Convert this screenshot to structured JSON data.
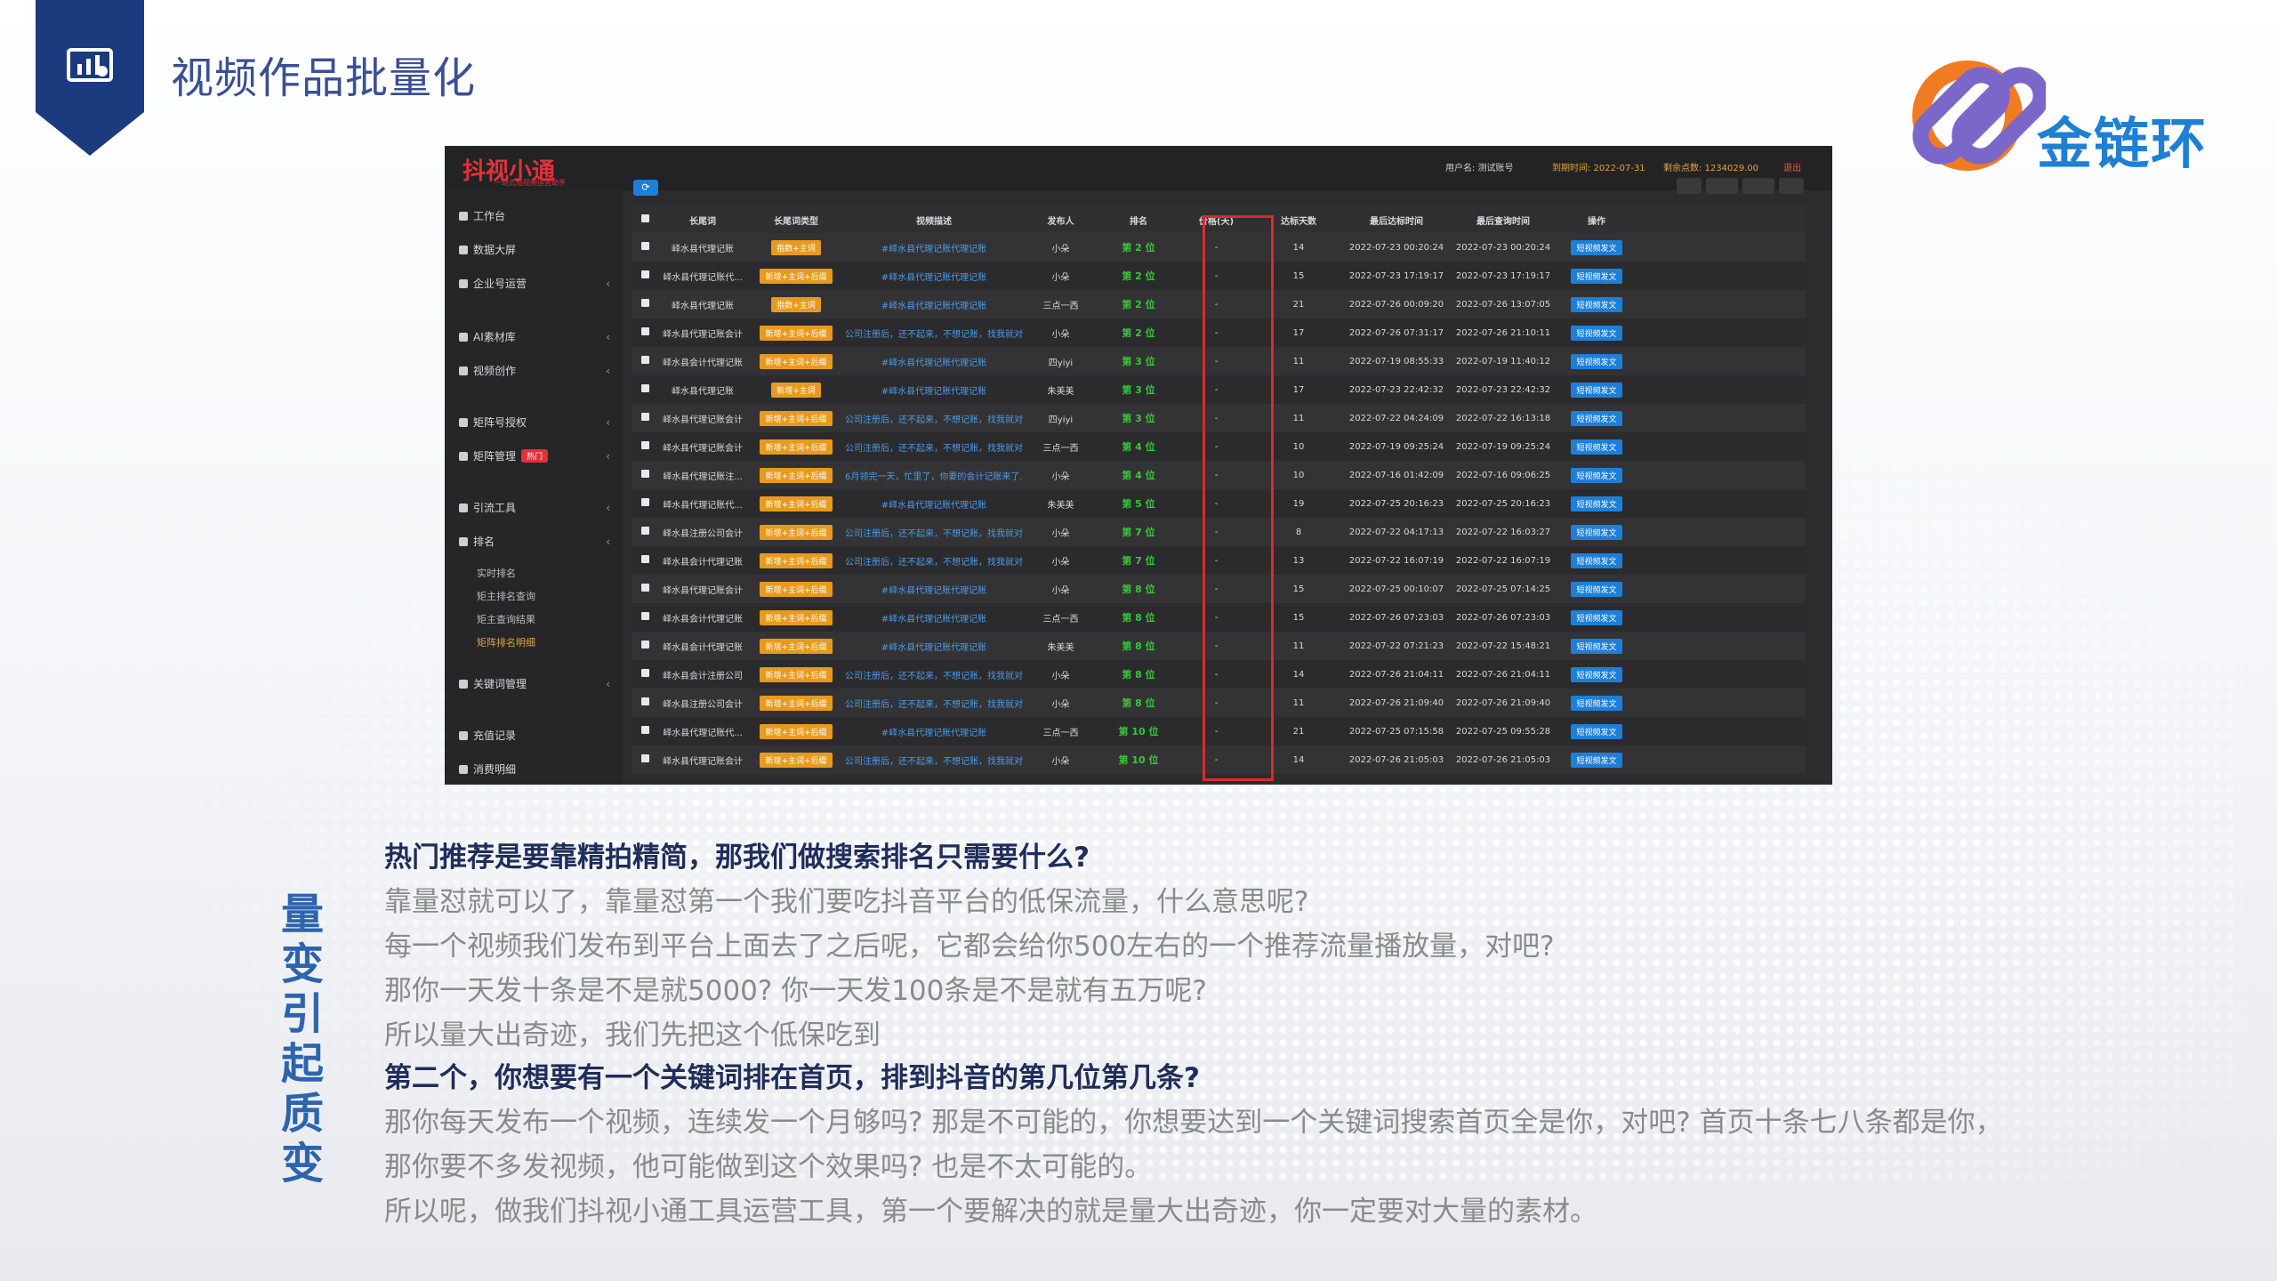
{
  "page": {
    "title": "视频作品批量化",
    "brand": "金链环",
    "side_title": "量变引起质变"
  },
  "app": {
    "logo": "抖视小通",
    "logo_sub": "一站式短视频运营助手",
    "user": "用户名: 测试账号",
    "expire": "到期时间: 2022-07-31",
    "balance": "剩余点数: 1234029.00",
    "logout": "退出"
  },
  "sidebar": [
    {
      "label": "工作台",
      "icon": "desktop-icon",
      "chev": false
    },
    {
      "label": "数据大屏",
      "icon": "chart-icon",
      "chev": false
    },
    {
      "label": "企业号运营",
      "icon": "cloud-icon",
      "chev": true
    },
    {
      "label": "AI素材库",
      "icon": "folder-icon",
      "chev": true
    },
    {
      "label": "视频创作",
      "icon": "film-icon",
      "chev": true
    },
    {
      "label": "矩阵号授权",
      "icon": "key-icon",
      "chev": true
    },
    {
      "label": "矩阵管理",
      "icon": "grid-icon",
      "chev": true,
      "badge": "热门"
    },
    {
      "label": "引流工具",
      "icon": "send-icon",
      "chev": true
    },
    {
      "label": "排名",
      "icon": "rank-icon",
      "chev": true
    },
    {
      "label": "实时排名",
      "sub": true
    },
    {
      "label": "矩主排名查询",
      "sub": true
    },
    {
      "label": "矩主查询结果",
      "sub": true
    },
    {
      "label": "矩阵排名明细",
      "sub": true,
      "active": true
    },
    {
      "label": "关键词管理",
      "icon": "doc-icon",
      "chev": true
    },
    {
      "label": "充值记录",
      "icon": "yen-icon",
      "chev": false
    },
    {
      "label": "消费明细",
      "icon": "list-icon",
      "chev": false
    }
  ],
  "table": {
    "headers": [
      "长尾词",
      "长尾词类型",
      "视频描述",
      "发布人",
      "排名",
      "价格(天)",
      "达标天数",
      "最后达标时间",
      "最后查询时间",
      "操作"
    ],
    "rows": [
      {
        "kw": "峄水县代理记账",
        "type": "指数+主词",
        "desc": "#峄水县代理记账代理记账",
        "pub": "小朵",
        "rank": "第 2 位",
        "price": "-",
        "days": "14",
        "last": "2022-07-23 00:20:24",
        "query": "2022-07-23 00:20:24",
        "op": "短视频发文"
      },
      {
        "kw": "峄水县代理记账代...",
        "type": "新增+主词+后缀",
        "desc": "#峄水县代理记账代理记账",
        "pub": "小朵",
        "rank": "第 2 位",
        "price": "-",
        "days": "15",
        "last": "2022-07-23 17:19:17",
        "query": "2022-07-23 17:19:17",
        "op": "短视频发文"
      },
      {
        "kw": "峄水县代理记账",
        "type": "指数+主词",
        "desc": "#峄水县代理记账代理记账",
        "pub": "三点一西",
        "rank": "第 2 位",
        "price": "-",
        "days": "21",
        "last": "2022-07-26 00:09:20",
        "query": "2022-07-26 13:07:05",
        "op": "短视频发文"
      },
      {
        "kw": "峄水县代理记账会计",
        "type": "新增+主词+后缀",
        "desc": "公司注册后，还不起来，不想记账，找我就对...",
        "pub": "小朵",
        "rank": "第 2 位",
        "price": "-",
        "days": "17",
        "last": "2022-07-26 07:31:17",
        "query": "2022-07-26 21:10:11",
        "op": "短视频发文"
      },
      {
        "kw": "峄水县会计代理记账",
        "type": "新增+主词+后缀",
        "desc": "#峄水县代理记账代理记账",
        "pub": "四yiyi",
        "rank": "第 3 位",
        "price": "-",
        "days": "11",
        "last": "2022-07-19 08:55:33",
        "query": "2022-07-19 11:40:12",
        "op": "短视频发文"
      },
      {
        "kw": "峄水县代理记账",
        "type": "新增+主词",
        "desc": "#峄水县代理记账代理记账",
        "pub": "朱美美",
        "rank": "第 3 位",
        "price": "-",
        "days": "17",
        "last": "2022-07-23 22:42:32",
        "query": "2022-07-23 22:42:32",
        "op": "短视频发文"
      },
      {
        "kw": "峄水县代理记账会计",
        "type": "新增+主词+后缀",
        "desc": "公司注册后，还不起来，不想记账，找我就对...",
        "pub": "四yiyi",
        "rank": "第 3 位",
        "price": "-",
        "days": "11",
        "last": "2022-07-22 04:24:09",
        "query": "2022-07-22 16:13:18",
        "op": "短视频发文"
      },
      {
        "kw": "峄水县代理记账会计",
        "type": "新增+主词+后缀",
        "desc": "公司注册后，还不起来，不想记账，找我就对...",
        "pub": "三点一西",
        "rank": "第 4 位",
        "price": "-",
        "days": "10",
        "last": "2022-07-19 09:25:24",
        "query": "2022-07-19 09:25:24",
        "op": "短视频发文"
      },
      {
        "kw": "峄水县代理记账注...",
        "type": "新增+主词+后缀",
        "desc": "6月领完一天，忙里了，你要的会计记账来了...",
        "pub": "小朵",
        "rank": "第 4 位",
        "price": "-",
        "days": "10",
        "last": "2022-07-16 01:42:09",
        "query": "2022-07-16 09:06:25",
        "op": "短视频发文"
      },
      {
        "kw": "峄水县代理记账代...",
        "type": "新增+主词+后缀",
        "desc": "#峄水县代理记账代理记账",
        "pub": "朱美美",
        "rank": "第 5 位",
        "price": "-",
        "days": "19",
        "last": "2022-07-25 20:16:23",
        "query": "2022-07-25 20:16:23",
        "op": "短视频发文"
      },
      {
        "kw": "峄水县注册公司会计",
        "type": "新增+主词+后缀",
        "desc": "公司注册后，还不起来，不想记账，找我就对...",
        "pub": "小朵",
        "rank": "第 7 位",
        "price": "-",
        "days": "8",
        "last": "2022-07-22 04:17:13",
        "query": "2022-07-22 16:03:27",
        "op": "短视频发文"
      },
      {
        "kw": "峄水县会计代理记账",
        "type": "新增+主词+后缀",
        "desc": "公司注册后，还不起来，不想记账，找我就对...",
        "pub": "小朵",
        "rank": "第 7 位",
        "price": "-",
        "days": "13",
        "last": "2022-07-22 16:07:19",
        "query": "2022-07-22 16:07:19",
        "op": "短视频发文"
      },
      {
        "kw": "峄水县代理记账会计",
        "type": "新增+主词+后缀",
        "desc": "#峄水县代理记账代理记账",
        "pub": "小朵",
        "rank": "第 8 位",
        "price": "-",
        "days": "15",
        "last": "2022-07-25 00:10:07",
        "query": "2022-07-25 07:14:25",
        "op": "短视频发文"
      },
      {
        "kw": "峄水县会计代理记账",
        "type": "新增+主词+后缀",
        "desc": "#峄水县代理记账代理记账",
        "pub": "三点一西",
        "rank": "第 8 位",
        "price": "-",
        "days": "15",
        "last": "2022-07-26 07:23:03",
        "query": "2022-07-26 07:23:03",
        "op": "短视频发文"
      },
      {
        "kw": "峄水县会计代理记账",
        "type": "新增+主词+后缀",
        "desc": "#峄水县代理记账代理记账",
        "pub": "朱美美",
        "rank": "第 8 位",
        "price": "-",
        "days": "11",
        "last": "2022-07-22 07:21:23",
        "query": "2022-07-22 15:48:21",
        "op": "短视频发文"
      },
      {
        "kw": "峄水县会计注册公司",
        "type": "新增+主词+后缀",
        "desc": "公司注册后，还不起来，不想记账，找我就对...",
        "pub": "小朵",
        "rank": "第 8 位",
        "price": "-",
        "days": "14",
        "last": "2022-07-26 21:04:11",
        "query": "2022-07-26 21:04:11",
        "op": "短视频发文"
      },
      {
        "kw": "峄水县注册公司会计",
        "type": "新增+主词+后缀",
        "desc": "公司注册后，还不起来，不想记账，找我就对...",
        "pub": "小朵",
        "rank": "第 8 位",
        "price": "-",
        "days": "11",
        "last": "2022-07-26 21:09:40",
        "query": "2022-07-26 21:09:40",
        "op": "短视频发文"
      },
      {
        "kw": "峄水县代理记账代...",
        "type": "新增+主词+后缀",
        "desc": "#峄水县代理记账代理记账",
        "pub": "三点一西",
        "rank": "第 10 位",
        "price": "-",
        "days": "21",
        "last": "2022-07-25 07:15:58",
        "query": "2022-07-25 09:55:28",
        "op": "短视频发文"
      },
      {
        "kw": "峄水县代理记账会计",
        "type": "新增+主词+后缀",
        "desc": "公司注册后，还不起来，不想记账，找我就对...",
        "pub": "小朵",
        "rank": "第 10 位",
        "price": "-",
        "days": "14",
        "last": "2022-07-26 21:05:03",
        "query": "2022-07-26 21:05:03",
        "op": "短视频发文"
      }
    ]
  },
  "paragraphs": [
    {
      "text": "热门推荐是要靠精拍精简，那我们做搜索排名只需要什么?",
      "bold": true
    },
    {
      "text": "靠量怼就可以了，靠量怼第一个我们要吃抖音平台的低保流量，什么意思呢?",
      "bold": false
    },
    {
      "text": "每一个视频我们发布到平台上面去了之后呢，它都会给你500左右的一个推荐流量播放量，对吧?",
      "bold": false
    },
    {
      "text": "那你一天发十条是不是就5000? 你一天发100条是不是就有五万呢?",
      "bold": false
    },
    {
      "text": "所以量大出奇迹，我们先把这个低保吃到",
      "bold": false
    },
    {
      "text": "第二个，你想要有一个关键词排在首页，排到抖音的第几位第几条?",
      "bold": true
    },
    {
      "text": "那你每天发布一个视频，连续发一个月够吗? 那是不可能的，你想要达到一个关键词搜索首页全是你，对吧? 首页十条七八条都是你，",
      "bold": false
    },
    {
      "text": "那你要不多发视频，他可能做到这个效果吗? 也是不太可能的。",
      "bold": false
    },
    {
      "text": "所以呢，做我们抖视小通工具运营工具，第一个要解决的就是量大出奇迹，你一定要对大量的素材。",
      "bold": false
    }
  ]
}
